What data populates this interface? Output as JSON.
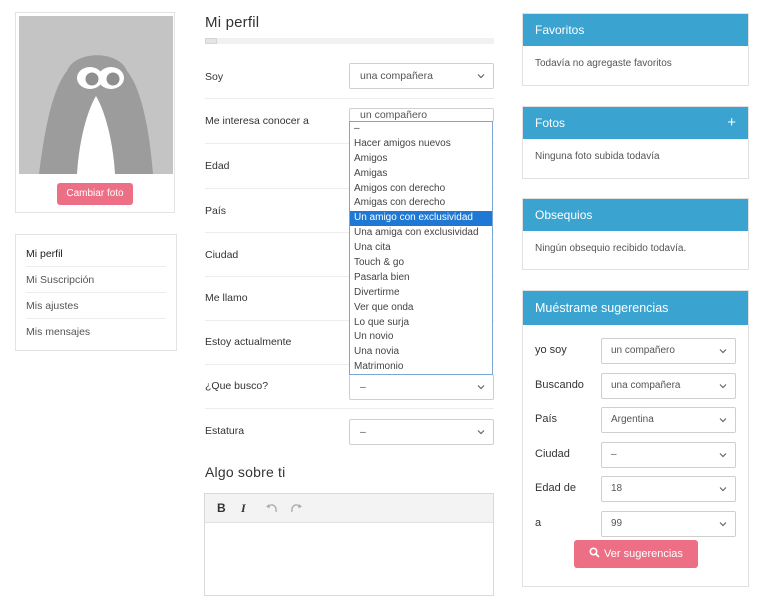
{
  "profile": {
    "change_photo_label": "Cambiar foto"
  },
  "side_nav": {
    "items": [
      {
        "label": "Mi perfil"
      },
      {
        "label": "Mi Suscripción"
      },
      {
        "label": "Mis ajustes"
      },
      {
        "label": "Mis mensajes"
      }
    ]
  },
  "form": {
    "title": "Mi perfil",
    "rows": [
      {
        "label": "Soy",
        "value": "una compañera"
      },
      {
        "label": "Me interesa conocer a",
        "value": "un compañero"
      },
      {
        "label": "Edad"
      },
      {
        "label": "País"
      },
      {
        "label": "Ciudad"
      },
      {
        "label": "Me llamo"
      },
      {
        "label": "Estoy actualmente"
      },
      {
        "label": "¿Que busco?",
        "value": "–"
      },
      {
        "label": "Estatura",
        "value": "–"
      }
    ],
    "dropdown_options": [
      "–",
      "Hacer amigos nuevos",
      "Amigos",
      "Amigas",
      "Amigos con derecho",
      "Amigas con derecho",
      "Un amigo con exclusividad",
      "Una amiga con exclusividad",
      "Una cita",
      "Touch & go",
      "Pasarla bien",
      "Divertirme",
      "Ver que onda",
      "Lo que surja",
      "Un novio",
      "Una novia",
      "Matrimonio"
    ],
    "dropdown_selected": "Un amigo con exclusividad",
    "about_title": "Algo sobre ti",
    "editor": {
      "bold": "B",
      "italic": "I"
    }
  },
  "panels": {
    "favoritos": {
      "title": "Favoritos",
      "text": "Todavía no agregaste favoritos"
    },
    "fotos": {
      "title": "Fotos",
      "text": "Ninguna foto subida todavía",
      "add": "+"
    },
    "obsequios": {
      "title": "Obsequios",
      "text": "Ningún obsequio recibido todavía."
    },
    "sugerencias": {
      "title": "Muéstrame sugerencias",
      "rows": [
        {
          "label": "yo soy",
          "value": "un compañero"
        },
        {
          "label": "Buscando",
          "value": "una compañera"
        },
        {
          "label": "País",
          "value": "Argentina"
        },
        {
          "label": "Ciudad",
          "value": "–"
        },
        {
          "label": "Edad de",
          "value": "18"
        },
        {
          "label": "a",
          "value": "99"
        }
      ],
      "button": "Ver sugerencias"
    }
  },
  "colors": {
    "accent": "#3ba3d0",
    "brand_pink": "#ec6f85",
    "selected": "#1e78d4"
  }
}
